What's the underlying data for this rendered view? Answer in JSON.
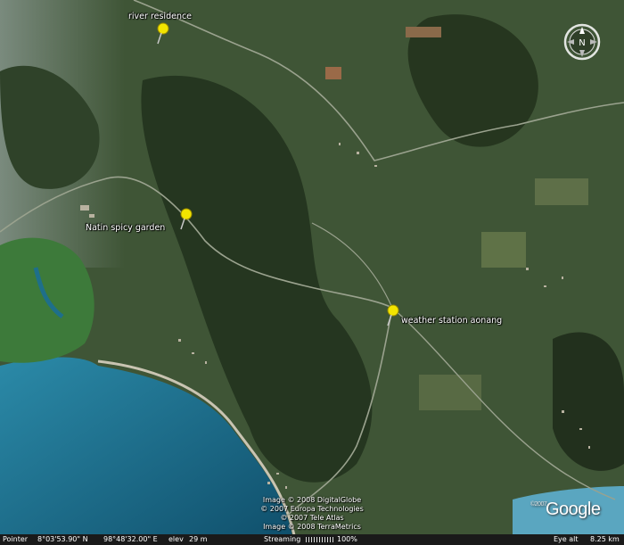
{
  "placemarks": [
    {
      "label": "river residence"
    },
    {
      "label": "Natin spicy garden"
    },
    {
      "label": "weather station aonang"
    }
  ],
  "compass": {
    "direction": "N"
  },
  "credits": [
    "Image © 2008 DigitalGlobe",
    "© 2007 Europa Technologies",
    "© 2007 Tele Atlas",
    "Image © 2008 TerraMetrics"
  ],
  "logo": {
    "text": "Google",
    "year": "©2007"
  },
  "status": {
    "pointer_label": "Pointer",
    "lat": "8°03'53.90\" N",
    "lon": "98°48'32.00\" E",
    "elev_label": "elev",
    "elev": "29 m",
    "streaming_label": "Streaming",
    "streaming_pct": "100%",
    "eye_label": "Eye alt",
    "eye_alt": "8.25 km"
  },
  "colors": {
    "land": "#3e5435",
    "hills": "#24331f",
    "sea": "#1c6a88",
    "pin": "#f2e400",
    "status_bg": "#1a1a1a"
  }
}
